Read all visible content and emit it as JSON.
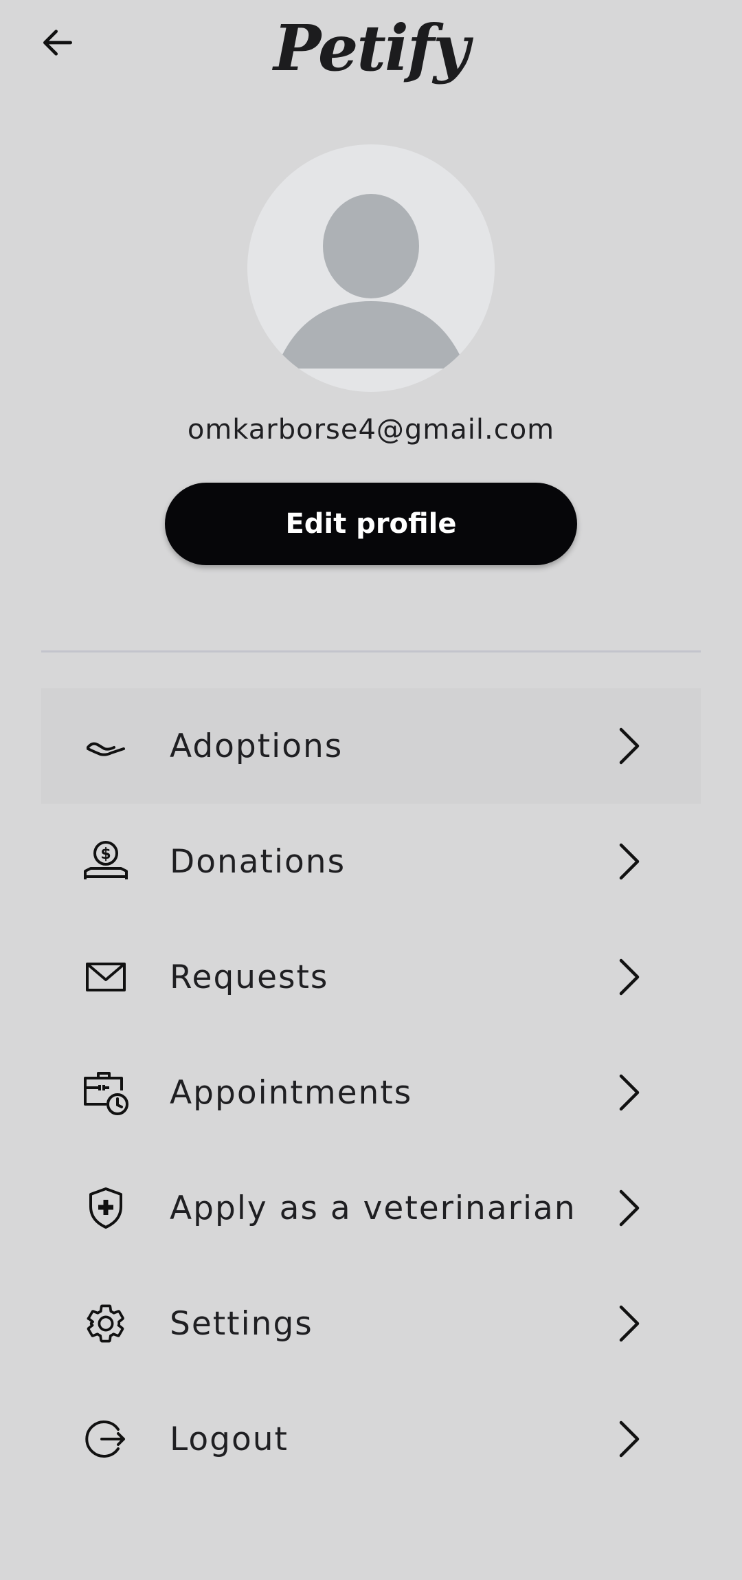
{
  "header": {
    "back_icon": "arrow-back-icon",
    "app_title": "Petify"
  },
  "profile": {
    "avatar_icon": "default-user-avatar",
    "email": "omkarborse4@gmail.com",
    "edit_button_label": "Edit profile"
  },
  "menu": {
    "items": [
      {
        "label": "Adoptions",
        "icon": "hand-icon",
        "highlighted": true
      },
      {
        "label": "Donations",
        "icon": "donation-coin-icon"
      },
      {
        "label": "Requests",
        "icon": "envelope-icon"
      },
      {
        "label": "Appointments",
        "icon": "briefcase-clock-icon"
      },
      {
        "label": "Apply as a veterinarian",
        "icon": "shield-plus-icon"
      },
      {
        "label": "Settings",
        "icon": "gear-icon"
      },
      {
        "label": "Logout",
        "icon": "logout-icon"
      }
    ]
  },
  "colors": {
    "background": "#d7d7d8",
    "button": "#060609",
    "button_text": "#ffffff",
    "highlight_row": "#d2d2d3",
    "avatar_bg": "#e4e5e7",
    "avatar_figure": "#adb1b5"
  }
}
